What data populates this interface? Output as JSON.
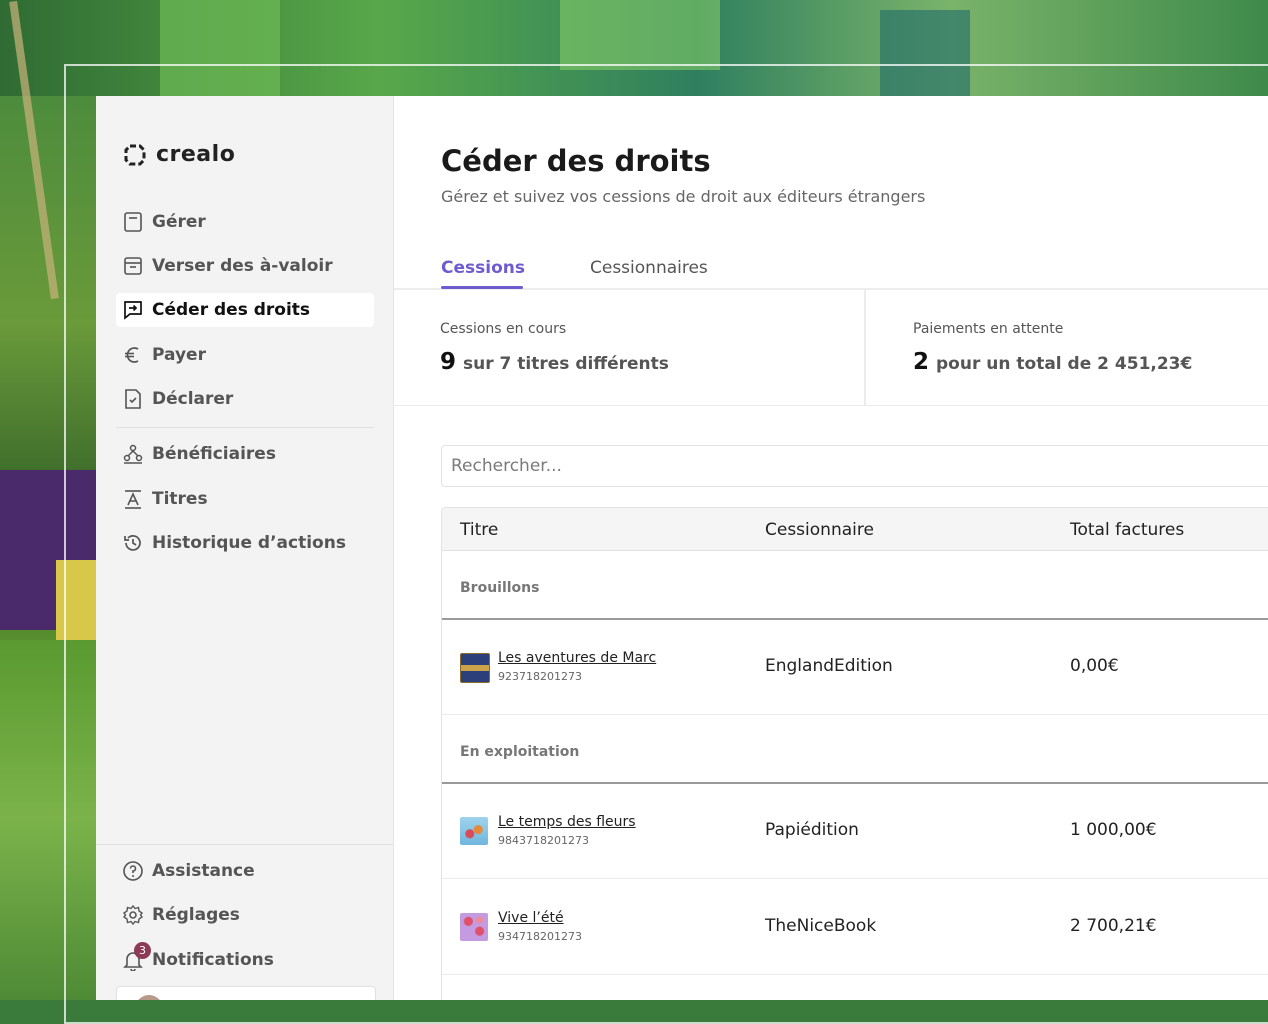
{
  "app": {
    "brand": "crealo"
  },
  "sidebar": {
    "items": [
      {
        "label": "Gérer",
        "icon": "document-icon"
      },
      {
        "label": "Verser des à-valoir",
        "icon": "archive-box-icon"
      },
      {
        "label": "Céder des droits",
        "icon": "transfer-chat-icon",
        "active": true
      },
      {
        "label": "Payer",
        "icon": "euro-icon"
      },
      {
        "label": "Déclarer",
        "icon": "document-check-icon"
      },
      {
        "label": "Bénéficiaires",
        "icon": "people-network-icon"
      },
      {
        "label": "Titres",
        "icon": "text-title-icon"
      },
      {
        "label": "Historique d’actions",
        "icon": "history-icon"
      }
    ],
    "bottom": [
      {
        "label": "Assistance",
        "icon": "help-circle-icon"
      },
      {
        "label": "Réglages",
        "icon": "gear-icon"
      },
      {
        "label": "Notifications",
        "icon": "bell-icon",
        "badge": "3"
      }
    ]
  },
  "page": {
    "title": "Céder des droits",
    "subtitle": "Gérez et suivez vos cessions de droit aux éditeurs étrangers"
  },
  "tabs": [
    {
      "label": "Cessions",
      "active": true
    },
    {
      "label": "Cessionnaires",
      "active": false
    }
  ],
  "stats": [
    {
      "label": "Cessions en cours",
      "number": "9",
      "text": "sur 7 titres différents"
    },
    {
      "label": "Paiements en attente",
      "number": "2",
      "text": "pour un total de 2 451,23€"
    }
  ],
  "search": {
    "placeholder": "Rechercher..."
  },
  "table": {
    "columns": [
      "Titre",
      "Cessionnaire",
      "Total factures"
    ],
    "groups": [
      {
        "label": "Brouillons",
        "rows": [
          {
            "title": "Les aventures de Marc",
            "isbn": "923718201273",
            "cessionnaire": "EnglandEdition",
            "total": "0,00€"
          }
        ]
      },
      {
        "label": "En exploitation",
        "rows": [
          {
            "title": "Le temps des fleurs",
            "isbn": "9843718201273",
            "cessionnaire": "Papiédition",
            "total": "1 000,00€"
          },
          {
            "title": "Vive l’été",
            "isbn": "934718201273",
            "cessionnaire": "TheNiceBook",
            "total": "2 700,21€"
          }
        ]
      }
    ]
  },
  "colors": {
    "accent": "#6f5bd0",
    "badge": "#8c3a55",
    "sidebar_bg": "#f3f3f3"
  }
}
